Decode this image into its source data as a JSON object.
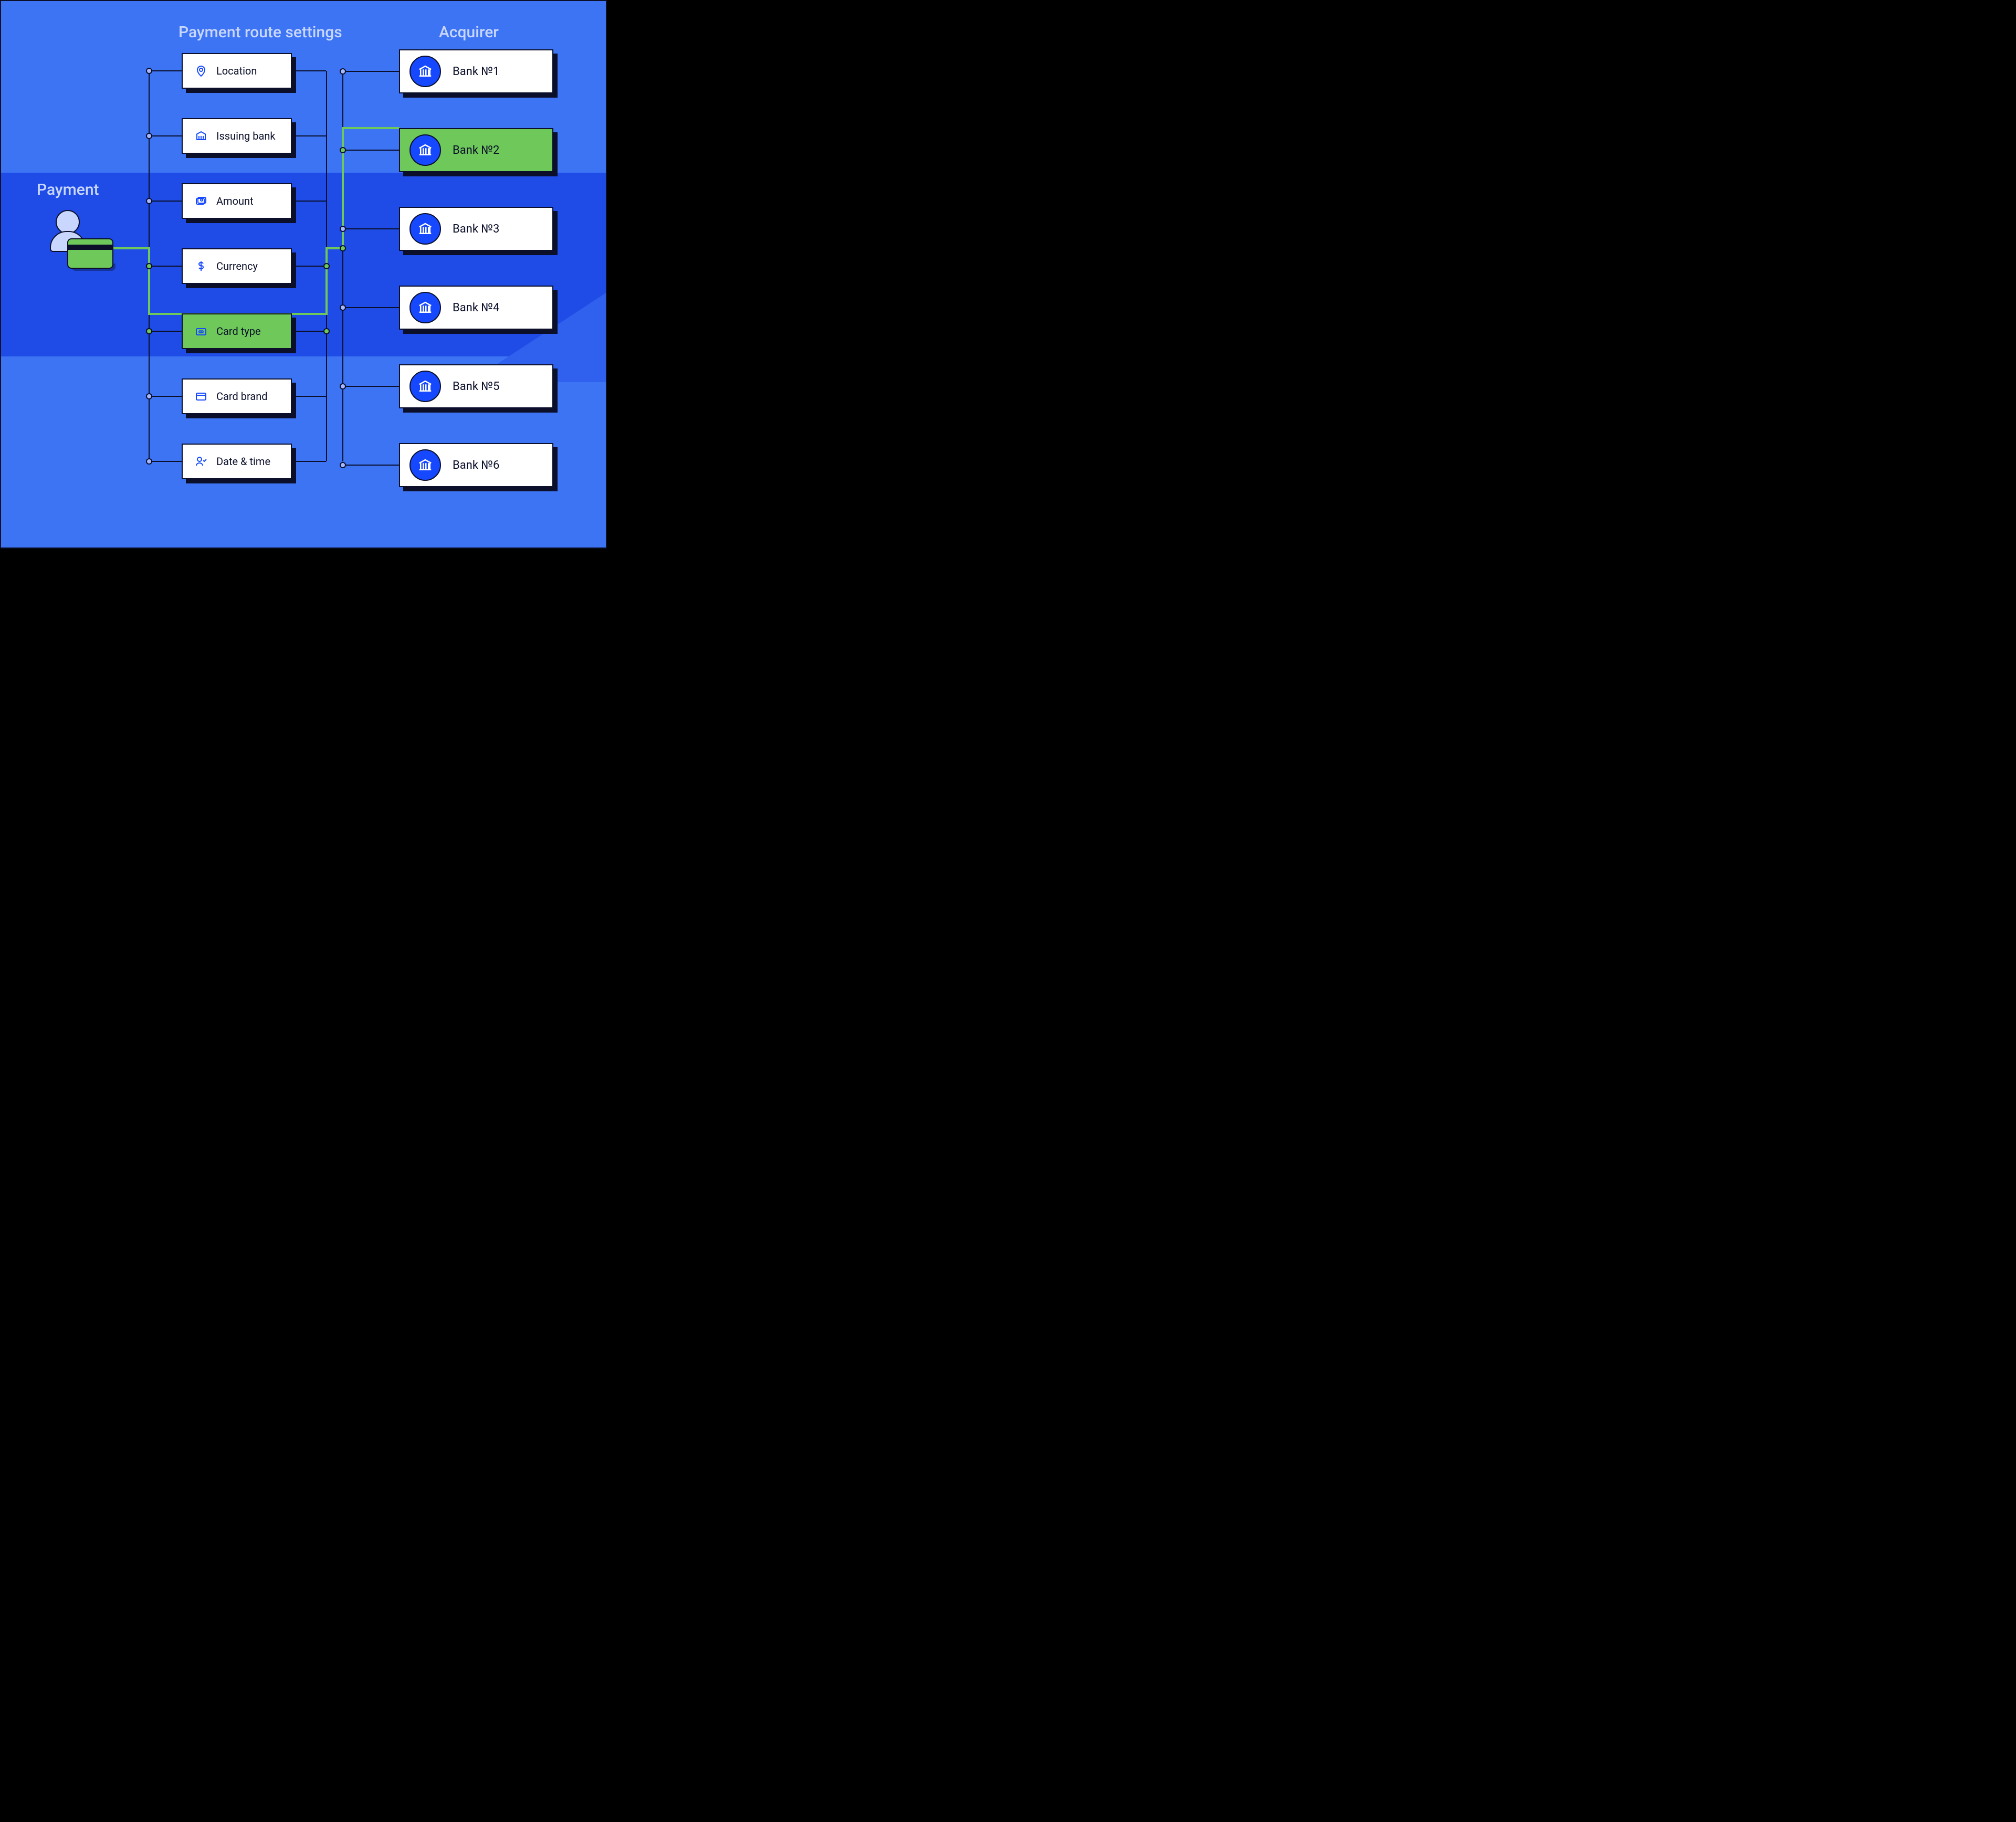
{
  "headings": {
    "payment": "Payment",
    "settings": "Payment route settings",
    "acquirer": "Acquirer"
  },
  "settings": [
    {
      "icon": "location-icon",
      "label": "Location",
      "active": false
    },
    {
      "icon": "bank-icon",
      "label": "Issuing bank",
      "active": false
    },
    {
      "icon": "amount-icon",
      "label": "Amount",
      "active": false
    },
    {
      "icon": "currency-icon",
      "label": "Currency",
      "active": false
    },
    {
      "icon": "card-type-icon",
      "label": "Card type",
      "active": true
    },
    {
      "icon": "card-brand-icon",
      "label": "Card brand",
      "active": false
    },
    {
      "icon": "datetime-icon",
      "label": "Date & time",
      "active": false
    }
  ],
  "acquirers": [
    {
      "label": "Bank №1",
      "active": false
    },
    {
      "label": "Bank №2",
      "active": true
    },
    {
      "label": "Bank №3",
      "active": false
    },
    {
      "label": "Bank №4",
      "active": false
    },
    {
      "label": "Bank №5",
      "active": false
    },
    {
      "label": "Bank №6",
      "active": false
    }
  ],
  "colors": {
    "background": "#3d74f4",
    "band": "#1f4ce6",
    "active": "#6ec95a",
    "card": "#ffffff",
    "iconBlue": "#1649ff"
  }
}
